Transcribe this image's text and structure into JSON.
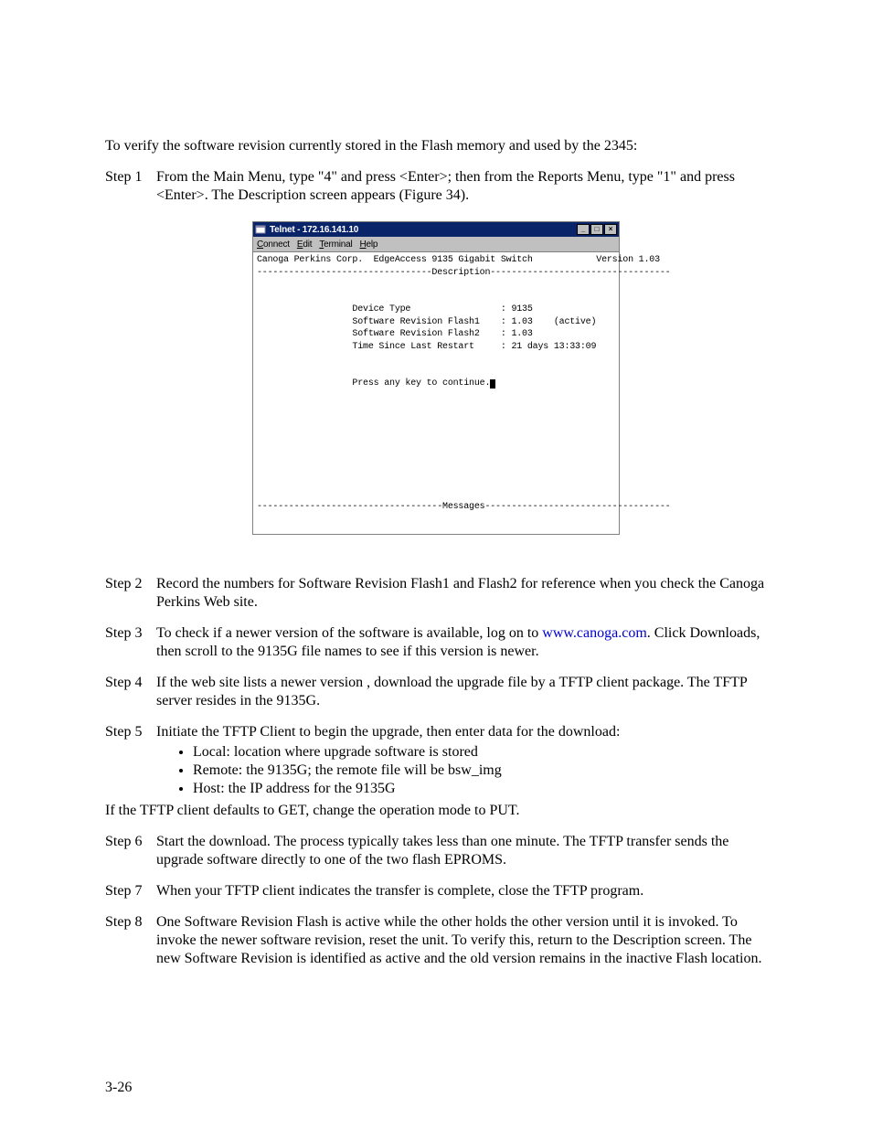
{
  "intro": "To verify the software revision currently stored in the Flash memory and used by the 2345:",
  "steps": {
    "s1": {
      "label": "Step 1",
      "text": "From the Main Menu, type \"4\" and press <Enter>; then from the Reports Menu, type \"1\" and press <Enter>.  The Description screen appears (Figure 34)."
    },
    "s2": {
      "label": "Step 2",
      "text": "Record the numbers for Software Revision Flash1 and Flash2 for reference when you check the Canoga Perkins Web site."
    },
    "s3": {
      "label": "Step 3",
      "pre": "To check if a newer version of the software is available, log on to ",
      "link": "www.canoga.com",
      "post": ".  Click Downloads, then scroll to the 9135G file names to see if this version is newer."
    },
    "s4": {
      "label": "Step 4",
      "text": "If the web site lists a newer version , download the upgrade file by a TFTP client package.  The TFTP server resides in the 9135G."
    },
    "s5": {
      "label": "Step 5",
      "text": "Initiate the TFTP Client to begin the upgrade, then enter data for the download:",
      "bullets": [
        "Local:  location where upgrade software is stored",
        "Remote:  the 9135G; the remote file will be bsw_img",
        "Host:  the IP address for the 9135G"
      ],
      "after": "If the TFTP client defaults to GET, change the operation mode to PUT."
    },
    "s6": {
      "label": "Step 6",
      "text": "Start the download. The process typically takes less than one minute.  The TFTP transfer sends the upgrade software directly to one of the two flash EPROMS."
    },
    "s7": {
      "label": "Step 7",
      "text": "When your TFTP client indicates the transfer is complete, close the TFTP program."
    },
    "s8": {
      "label": "Step 8",
      "text": "One Software Revision Flash is active while the other holds the other version until it is invoked.  To invoke the newer software revision, reset the unit.  To verify this, return to the Description screen.  The new Software Revision is identified as active and the old version remains in the inactive Flash location."
    }
  },
  "pageNumber": "3-26",
  "telnet": {
    "title": "Telnet - 172.16.141.10",
    "menu": {
      "connect": "Connect",
      "edit": "Edit",
      "terminal": "Terminal",
      "help": "Help"
    },
    "buttons": {
      "min": "_",
      "max": "□",
      "close": "×"
    },
    "header": {
      "company": "Canoga Perkins Corp.",
      "product": "EdgeAccess 9135 Gigabit Switch",
      "version": "Version 1.03"
    },
    "sectionDescription": "Description",
    "fields": {
      "deviceTypeLabel": "Device Type",
      "deviceTypeValue": "9135",
      "flash1Label": "Software Revision Flash1",
      "flash1Value": "1.03",
      "flash1Status": "(active)",
      "flash2Label": "Software Revision Flash2",
      "flash2Value": "1.03",
      "restartLabel": "Time Since Last Restart",
      "restartValue": "21 days 13:33:09"
    },
    "continue": "Press any key to continue.",
    "sectionMessages": "Messages"
  }
}
